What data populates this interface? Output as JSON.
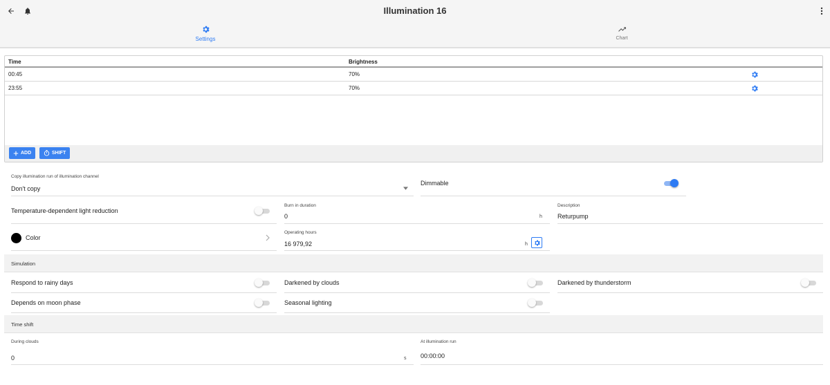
{
  "header": {
    "title": "Illumination 16"
  },
  "tabs": [
    {
      "label": "Settings",
      "icon": "gear-icon",
      "active": true
    },
    {
      "label": "Chart",
      "icon": "trending-up-icon",
      "active": false
    }
  ],
  "schedule": {
    "columns": [
      "Time",
      "Brightness"
    ],
    "rows": [
      {
        "time": "00:45",
        "brightness": "70%"
      },
      {
        "time": "23:55",
        "brightness": "70%"
      }
    ],
    "add_label": "ADD",
    "shift_label": "SHIFT"
  },
  "form": {
    "copy_label": "Copy illumination run of illumination channel",
    "copy_value": "Don't copy",
    "dimmable_label": "Dimmable",
    "dimmable_on": true,
    "temp_reduction_label": "Temperature-dependent light reduction",
    "temp_reduction_on": false,
    "burn_in_label": "Burn in duration",
    "burn_in_value": "0",
    "burn_in_unit": "h",
    "description_label": "Description",
    "description_value": "Returpump",
    "color_label": "Color",
    "color_value": "#000000",
    "operating_label": "Operating hours",
    "operating_value": "16 979,92",
    "operating_unit": "h"
  },
  "simulation": {
    "title": "Simulation",
    "rainy_label": "Respond to rainy days",
    "clouds_label": "Darkened by clouds",
    "thunder_label": "Darkened by thunderstorm",
    "moon_label": "Depends on moon phase",
    "seasonal_label": "Seasonal lighting"
  },
  "time_shift": {
    "title": "Time shift",
    "clouds_label": "During clouds",
    "clouds_value": "0",
    "clouds_unit": "s",
    "run_label": "At illumination run",
    "run_value": "00:00:00"
  },
  "colors": {
    "accent": "#2d7bf4",
    "button": "#3b82f0"
  }
}
